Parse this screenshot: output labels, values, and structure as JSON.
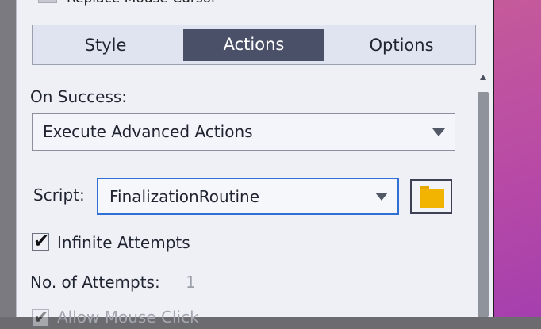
{
  "top_partial": {
    "label": "Replace Mouse Cursor"
  },
  "tabs": [
    {
      "label": "Style"
    },
    {
      "label": "Actions"
    },
    {
      "label": "Options"
    }
  ],
  "active_tab": "Actions",
  "on_success": {
    "label": "On Success:",
    "value": "Execute Advanced Actions"
  },
  "script": {
    "label": "Script:",
    "value": "FinalizationRoutine"
  },
  "infinite_attempts": {
    "label": "Infinite Attempts",
    "checked": true,
    "checkmark": "✔"
  },
  "attempts": {
    "label": "No. of Attempts:",
    "value": "1"
  },
  "allow_mouse_click": {
    "label": "Allow Mouse Click",
    "checked": true,
    "disabled": true,
    "checkmark": "✔"
  },
  "icons": {
    "folder": "folder-icon",
    "dropdown_arrow": "chevron-down-icon",
    "scroll_up": "scroll-up-arrow-icon"
  },
  "colors": {
    "active_tab_bg": "#4a5068",
    "focus_border": "#2f6fd6",
    "folder": "#f2b400"
  }
}
